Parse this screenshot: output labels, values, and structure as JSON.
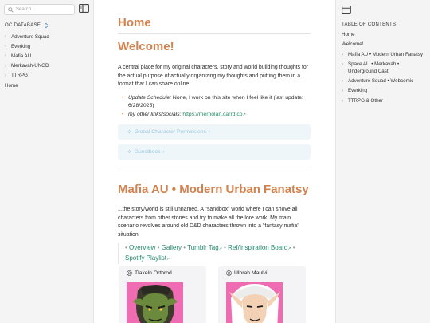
{
  "left_sidebar": {
    "search_placeholder": "Search...",
    "db_label": "OC DATABASE",
    "items": [
      {
        "label": "Adventure Squad",
        "expandable": true
      },
      {
        "label": "Everking",
        "expandable": true
      },
      {
        "label": "Mafia AU",
        "expandable": true
      },
      {
        "label": "Merkavah-UNGD",
        "expandable": true
      },
      {
        "label": "TTRPG",
        "expandable": true
      },
      {
        "label": "Home",
        "expandable": false
      }
    ]
  },
  "main": {
    "page_title": "Home",
    "welcome_heading": "Welcome!",
    "intro": "A central place for my original characters, story and world building thoughts for the actual purpose of actually organizing my thoughts and putting them in a format that I can share online.",
    "update_label": "Update Schedule:",
    "update_text": " None, I work on this site when I feel like it (last update: 6/28/2025)",
    "links_label": "my other links/socials:",
    "links_url": "https://mernolan.carrd.co",
    "callout_permissions": "Global Character Permissions",
    "callout_guestbook": "Guestbook",
    "mafia_heading": "Mafia AU • Modern Urban Fanatsy",
    "mafia_text": "...the story/world is still unnamed. A \"sandbox\" world where I can shove all characters from other stories and try to make all the lore work. My main scenario revolves around old D&D characters thrown into a \"fantasy mafia\" situation.",
    "mafia_links": {
      "overview": "Overview",
      "gallery": "Gallery",
      "tumblr": "Tumblr Tag",
      "ref": "Ref/Inspiration Board",
      "spotify": "Spotify Playlist"
    },
    "cards": [
      {
        "name": "Tlakeln Orthrod"
      },
      {
        "name": "Ulhrah Maulvi"
      }
    ]
  },
  "right_sidebar": {
    "title": "TABLE OF CONTENTS",
    "items": [
      {
        "label": "Home",
        "expandable": false
      },
      {
        "label": "Welcome!",
        "expandable": false
      },
      {
        "label": "Mafia AU • Modern Urban Fanatsy",
        "expandable": true
      },
      {
        "label": "Space AU • Merkavah • Underground Cast",
        "expandable": true
      },
      {
        "label": "Adventure Squad • Webcomic",
        "expandable": true
      },
      {
        "label": "Everking",
        "expandable": true
      },
      {
        "label": "TTRPG & Other",
        "expandable": true
      }
    ]
  },
  "colors": {
    "heading": "#d2824f",
    "link": "#22886b",
    "callout_bg": "#eef6fa",
    "card_image_bg": "#f06cb2"
  }
}
